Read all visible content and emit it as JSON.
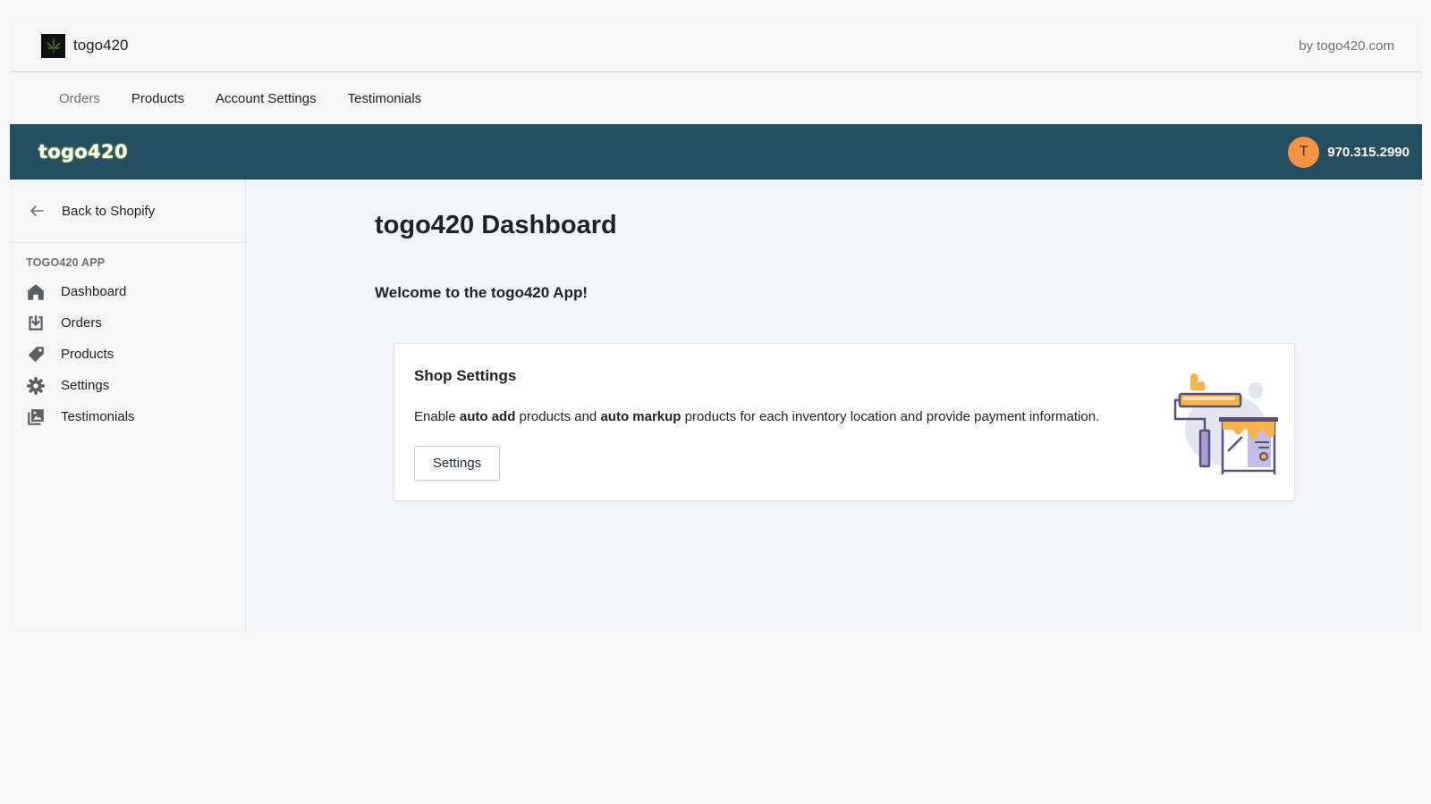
{
  "app_bar": {
    "app_name": "togo420",
    "by_label": "by togo420.com"
  },
  "nav_tabs": [
    {
      "label": "Orders"
    },
    {
      "label": "Products"
    },
    {
      "label": "Account Settings"
    },
    {
      "label": "Testimonials"
    }
  ],
  "brand_bar": {
    "logo_text": "togo420",
    "avatar_initial": "T",
    "phone": "970.315.2990",
    "bg_color": "#234f61",
    "avatar_color": "#f49342"
  },
  "sidebar": {
    "back_label": "Back to Shopify",
    "section_title": "TOGO420 APP",
    "items": [
      {
        "label": "Dashboard",
        "icon": "home-icon"
      },
      {
        "label": "Orders",
        "icon": "inbox-download-icon"
      },
      {
        "label": "Products",
        "icon": "tag-icon"
      },
      {
        "label": "Settings",
        "icon": "gear-icon"
      },
      {
        "label": "Testimonials",
        "icon": "images-icon"
      }
    ]
  },
  "main": {
    "title": "togo420 Dashboard",
    "welcome": "Welcome to the togo420 App!",
    "card": {
      "title": "Shop Settings",
      "desc_parts": [
        "Enable ",
        "auto add",
        " products and ",
        "auto markup",
        " products for each inventory location and provide payment information."
      ],
      "button_label": "Settings",
      "illustration": "paint-roller-illustration"
    }
  }
}
